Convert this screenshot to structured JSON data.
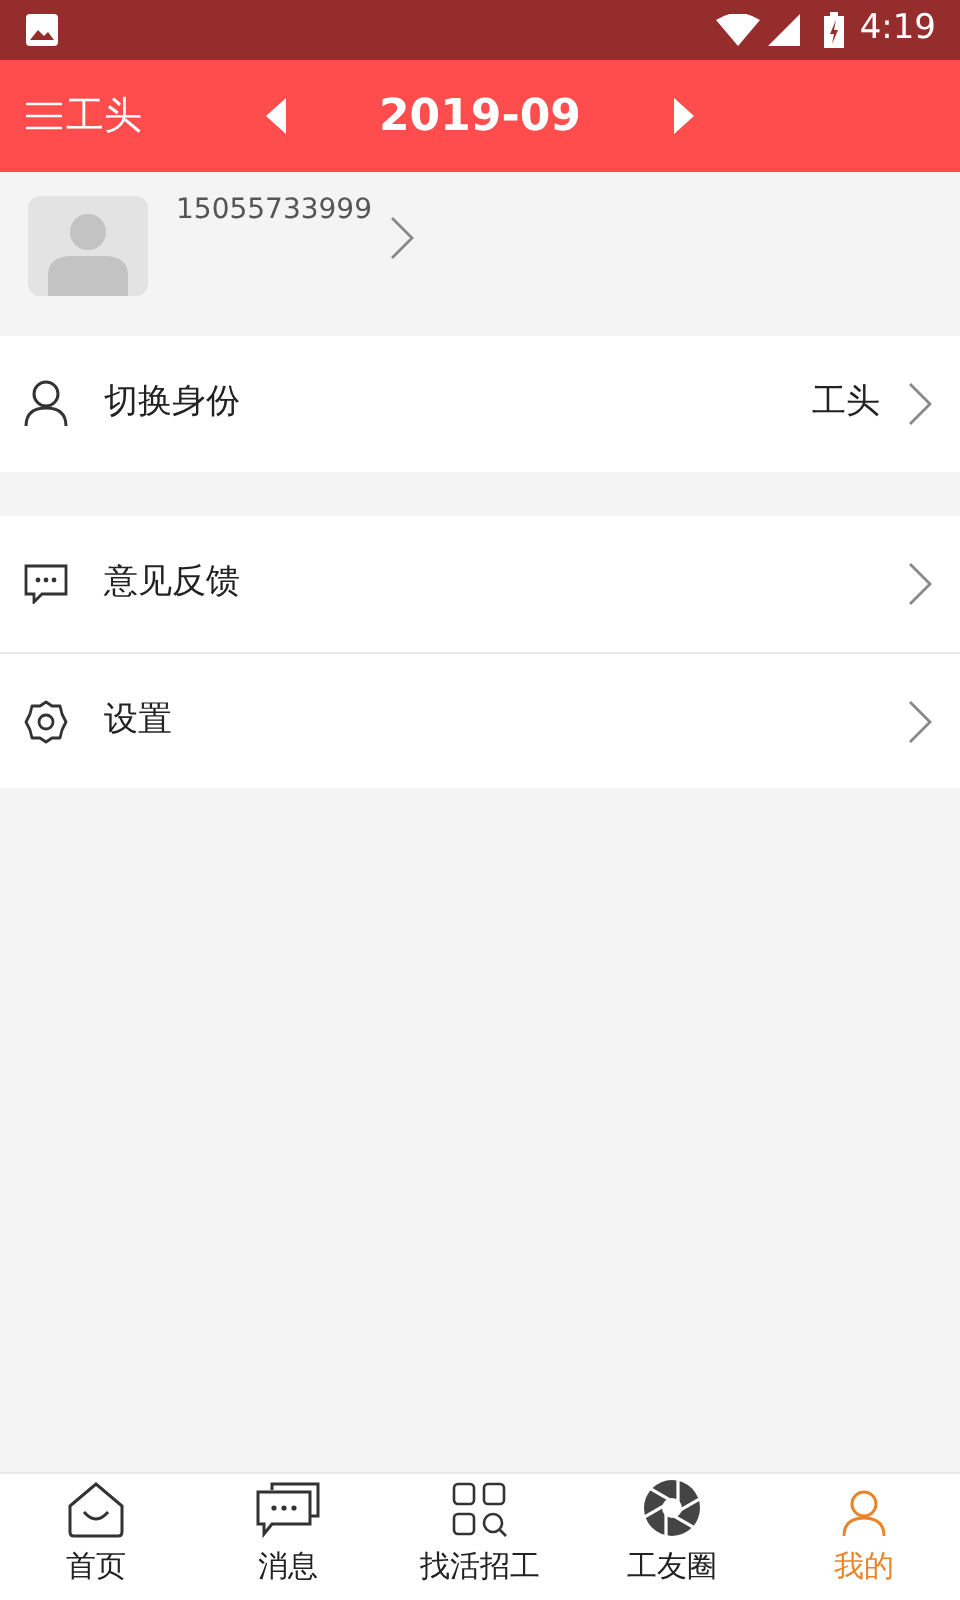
{
  "status_bar": {
    "time": "4:19"
  },
  "header": {
    "role": "工头",
    "month": "2019-09"
  },
  "profile": {
    "phone": "15055733999"
  },
  "menu_groups": [
    [
      {
        "kind": "person",
        "label": "切换身份",
        "value": "工头"
      }
    ],
    [
      {
        "kind": "chat",
        "label": "意见反馈"
      },
      {
        "kind": "gear",
        "label": "设置"
      }
    ]
  ],
  "tabs": [
    {
      "kind": "home",
      "label": "首页",
      "selected": false
    },
    {
      "kind": "messages",
      "label": "消息",
      "selected": false
    },
    {
      "kind": "grid",
      "label": "找活招工",
      "selected": false
    },
    {
      "kind": "shutter",
      "label": "工友圈",
      "selected": false
    },
    {
      "kind": "person",
      "label": "我的",
      "selected": true
    }
  ]
}
